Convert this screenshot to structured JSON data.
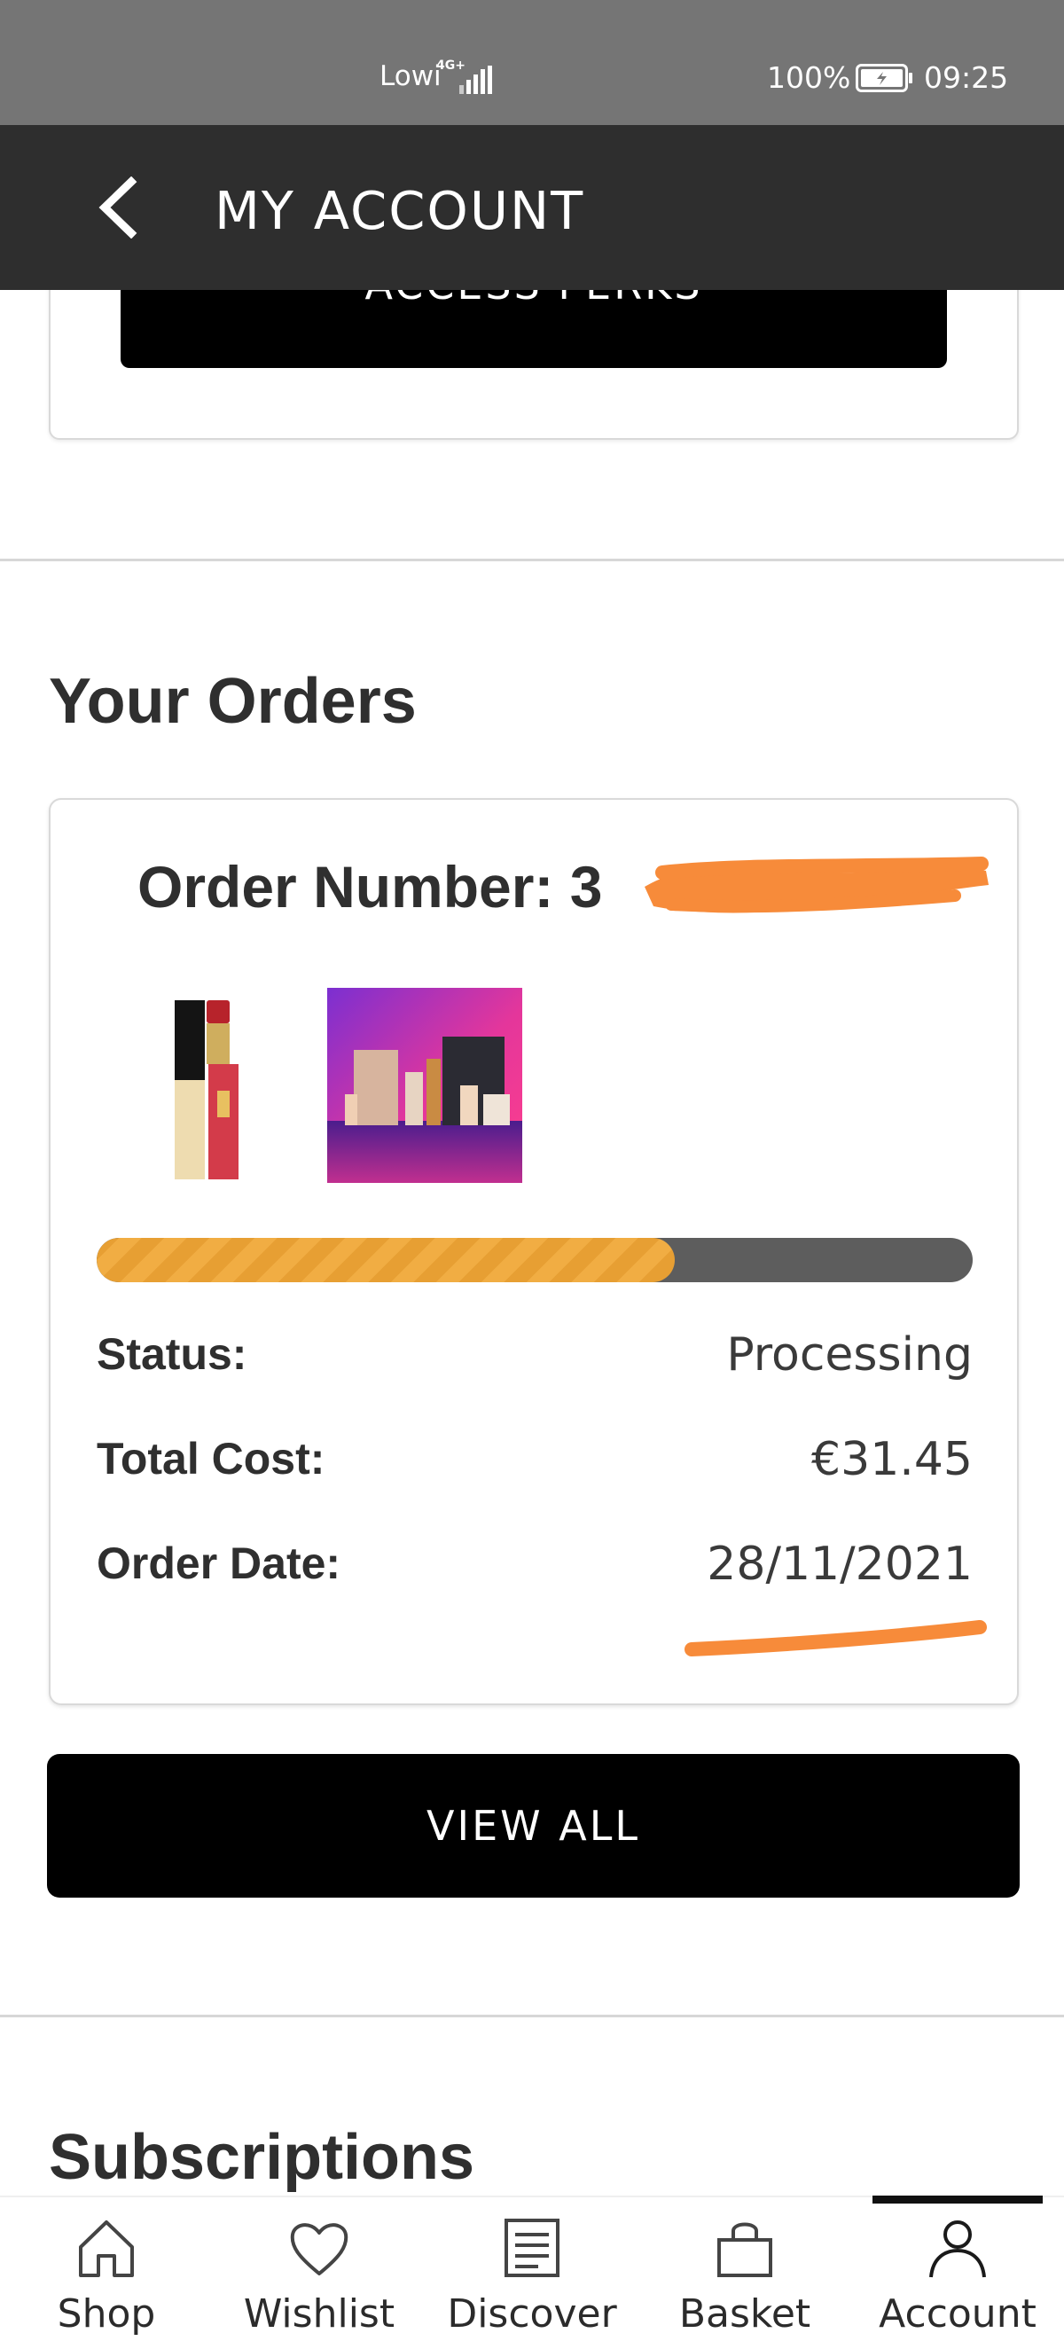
{
  "status_bar": {
    "carrier": "Lowi",
    "network_tag": "4G+",
    "battery_percent": "100%",
    "time": "09:25"
  },
  "header": {
    "title": "MY ACCOUNT",
    "back_icon": "chevron-left-icon"
  },
  "perks": {
    "button_label": "ACCESS PERKS"
  },
  "orders": {
    "section_title": "Your Orders",
    "order_number_label": "Order Number: 3",
    "order_number_redacted": true,
    "items": [
      {
        "kind": "lipstick"
      },
      {
        "kind": "beauty-box"
      }
    ],
    "progress_fraction": 0.66,
    "progress_colors": {
      "fill": "#e79f33",
      "track": "#5d5d5d"
    },
    "rows": [
      {
        "label": "Status:",
        "value": "Processing"
      },
      {
        "label": "Total Cost:",
        "value": "€31.45"
      },
      {
        "label": "Order Date:",
        "value": "28/11/2021"
      }
    ],
    "view_all_label": "VIEW ALL"
  },
  "subscriptions": {
    "section_title": "Subscriptions"
  },
  "bottom_nav": {
    "items": [
      {
        "label": "Shop",
        "icon": "home-icon"
      },
      {
        "label": "Wishlist",
        "icon": "heart-icon"
      },
      {
        "label": "Discover",
        "icon": "document-icon"
      },
      {
        "label": "Basket",
        "icon": "bag-icon"
      },
      {
        "label": "Account",
        "icon": "user-icon"
      }
    ],
    "active": "Account"
  },
  "colors": {
    "status_bar": "#757575",
    "header": "#2e2e2e",
    "redaction": "#f78b3a"
  }
}
